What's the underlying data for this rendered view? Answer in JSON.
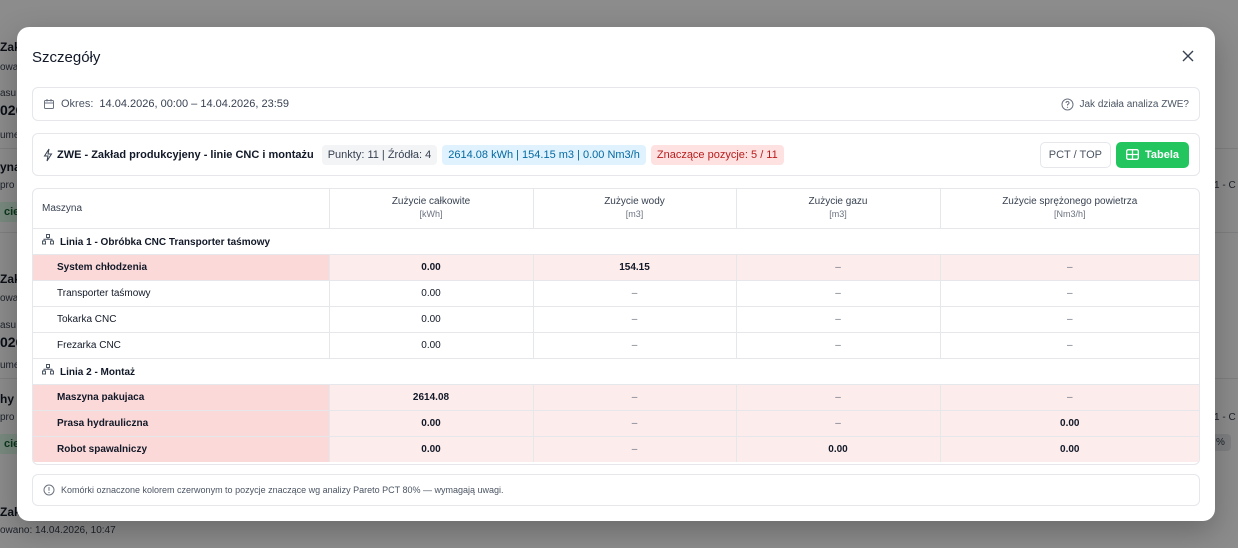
{
  "background": {
    "texts": [
      "Zak",
      "owa",
      "asu",
      "026",
      "ume",
      "yna",
      "pro",
      "Zak",
      "owa",
      "asu",
      "026",
      "ume",
      "hy",
      "pro",
      "Zak",
      "owano: 14.04.2026, 10:47"
    ],
    "chips": [
      "cie c",
      "cie c",
      "1 - C",
      "1 - C",
      "%"
    ]
  },
  "modal": {
    "title": "Szczegóły",
    "period": {
      "label": "Okres:",
      "value": "14.04.2026, 00:00 – 14.04.2026, 23:59",
      "help": "Jak działa analiza ZWE?"
    },
    "summary": {
      "title": "ZWE - Zakład produkcyjeny - linie CNC i montażu",
      "points": "Punkty: 11 | Źródła: 4",
      "totals": "2614.08 kWh | 154.15 m3 | 0.00 Nm3/h",
      "significant": "Znaczące pozycje: 5 / 11",
      "btn_pct": "PCT / TOP",
      "btn_table": "Tabela"
    },
    "table": {
      "columns": [
        {
          "label": "Maszyna",
          "unit": ""
        },
        {
          "label": "Zużycie całkowite",
          "unit": "[kWh]"
        },
        {
          "label": "Zużycie wody",
          "unit": "[m3]"
        },
        {
          "label": "Zużycie gazu",
          "unit": "[m3]"
        },
        {
          "label": "Zużycie sprężonego powietrza",
          "unit": "[Nm3/h]"
        }
      ],
      "groups": [
        {
          "name": "Linia 1 - Obróbka CNC Transporter taśmowy",
          "rows": [
            {
              "name": "System chłodzenia",
              "highlight": true,
              "values": [
                "0.00",
                "154.15",
                "–",
                "–"
              ]
            },
            {
              "name": "Transporter taśmowy",
              "highlight": false,
              "values": [
                "0.00",
                "–",
                "–",
                "–"
              ]
            },
            {
              "name": "Tokarka CNC",
              "highlight": false,
              "values": [
                "0.00",
                "–",
                "–",
                "–"
              ]
            },
            {
              "name": "Frezarka CNC",
              "highlight": false,
              "values": [
                "0.00",
                "–",
                "–",
                "–"
              ]
            }
          ]
        },
        {
          "name": "Linia 2 - Montaż",
          "rows": [
            {
              "name": "Maszyna pakujaca",
              "highlight": true,
              "values": [
                "2614.08",
                "–",
                "–",
                "–"
              ]
            },
            {
              "name": "Prasa hydrauliczna",
              "highlight": true,
              "values": [
                "0.00",
                "–",
                "–",
                "0.00"
              ]
            },
            {
              "name": "Robot spawalniczy",
              "highlight": true,
              "values": [
                "0.00",
                "–",
                "0.00",
                "0.00"
              ]
            }
          ]
        }
      ]
    },
    "footnote": "Komórki oznaczone kolorem czerwonym to pozycje znaczące wg analizy Pareto PCT 80% — wymagają uwagi."
  },
  "colors": {
    "accent_green": "#22c55e",
    "highlight_red": "#fdecec",
    "tag_blue": "#e0f2fe",
    "tag_red": "#fee2e2"
  }
}
